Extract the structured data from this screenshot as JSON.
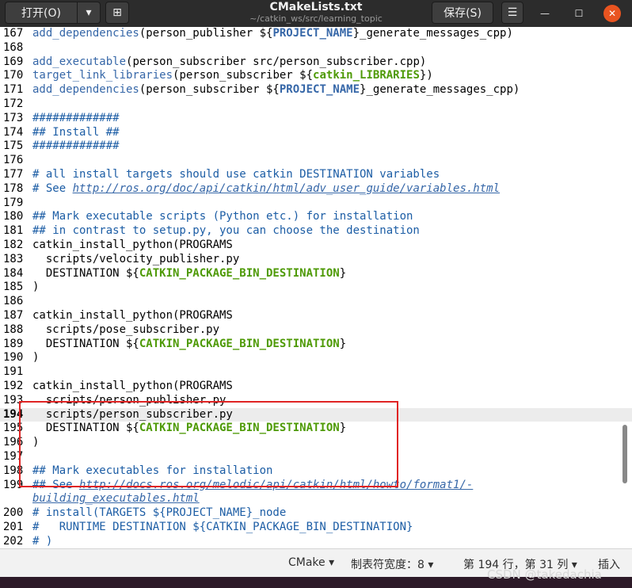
{
  "titlebar": {
    "open_label": "打开(O)",
    "title": "CMakeLists.txt",
    "path": "~/catkin_ws/src/learning_topic",
    "save_label": "保存(S)"
  },
  "editor": {
    "current_line": "194",
    "lines": [
      {
        "n": "167",
        "t": "add_dependencies(person_publisher ${PROJECT_NAME}_generate_messages_cpp)"
      },
      {
        "n": "168",
        "t": ""
      },
      {
        "n": "169",
        "t": "add_executable(person_subscriber src/person_subscriber.cpp)"
      },
      {
        "n": "170",
        "t": "target_link_libraries(person_subscriber ${catkin_LIBRARIES})"
      },
      {
        "n": "171",
        "t": "add_dependencies(person_subscriber ${PROJECT_NAME}_generate_messages_cpp)"
      },
      {
        "n": "172",
        "t": ""
      },
      {
        "n": "173",
        "t": "#############"
      },
      {
        "n": "174",
        "t": "## Install ##"
      },
      {
        "n": "175",
        "t": "#############"
      },
      {
        "n": "176",
        "t": ""
      },
      {
        "n": "177",
        "t": "# all install targets should use catkin DESTINATION variables"
      },
      {
        "n": "178",
        "t": "# See http://ros.org/doc/api/catkin/html/adv_user_guide/variables.html"
      },
      {
        "n": "179",
        "t": ""
      },
      {
        "n": "180",
        "t": "## Mark executable scripts (Python etc.) for installation"
      },
      {
        "n": "181",
        "t": "## in contrast to setup.py, you can choose the destination"
      },
      {
        "n": "182",
        "t": "catkin_install_python(PROGRAMS"
      },
      {
        "n": "183",
        "t": "  scripts/velocity_publisher.py"
      },
      {
        "n": "184",
        "t": "  DESTINATION ${CATKIN_PACKAGE_BIN_DESTINATION}"
      },
      {
        "n": "185",
        "t": ")"
      },
      {
        "n": "186",
        "t": ""
      },
      {
        "n": "187",
        "t": "catkin_install_python(PROGRAMS"
      },
      {
        "n": "188",
        "t": "  scripts/pose_subscriber.py"
      },
      {
        "n": "189",
        "t": "  DESTINATION ${CATKIN_PACKAGE_BIN_DESTINATION}"
      },
      {
        "n": "190",
        "t": ")"
      },
      {
        "n": "191",
        "t": ""
      },
      {
        "n": "192",
        "t": "catkin_install_python(PROGRAMS"
      },
      {
        "n": "193",
        "t": "  scripts/person_publisher.py"
      },
      {
        "n": "194",
        "t": "  scripts/person_subscriber.py"
      },
      {
        "n": "195",
        "t": "  DESTINATION ${CATKIN_PACKAGE_BIN_DESTINATION}"
      },
      {
        "n": "196",
        "t": ")"
      },
      {
        "n": "197",
        "t": ""
      },
      {
        "n": "198",
        "t": "## Mark executables for installation"
      },
      {
        "n": "199",
        "t": "## See http://docs.ros.org/melodic/api/catkin/html/howto/format1/-"
      },
      {
        "n": "",
        "t": "building_executables.html"
      },
      {
        "n": "200",
        "t": "# install(TARGETS ${PROJECT_NAME}_node"
      },
      {
        "n": "201",
        "t": "#   RUNTIME DESTINATION ${CATKIN_PACKAGE_BIN_DESTINATION}"
      },
      {
        "n": "202",
        "t": "# )"
      }
    ]
  },
  "statusbar": {
    "language": "CMake ▾",
    "tab_width": "制表符宽度：8 ▾",
    "position": "第 194 行，第 31 列 ▾",
    "mode": "插入"
  },
  "watermark": "CSDN @takedachia"
}
